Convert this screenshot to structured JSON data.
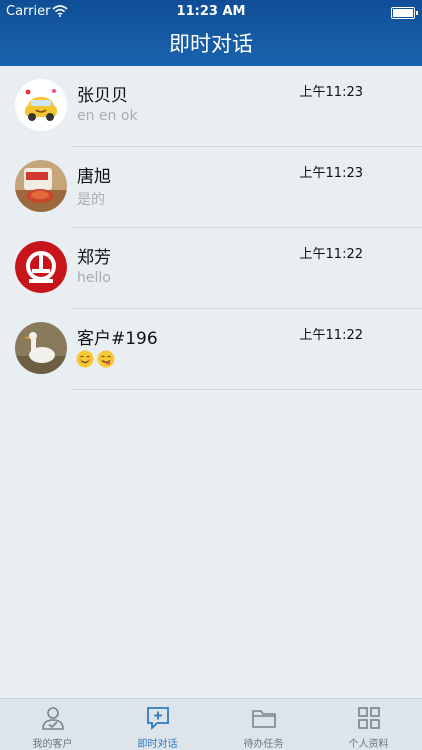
{
  "status_bar": {
    "carrier": "Carrier",
    "time": "11:23 AM"
  },
  "nav": {
    "title": "即时对话"
  },
  "conversations": [
    {
      "name": "张贝贝",
      "time": "上午11:23",
      "preview": "en en ok"
    },
    {
      "name": "唐旭",
      "time": "上午11:23",
      "preview": "是的"
    },
    {
      "name": "郑芳",
      "time": "上午11:22",
      "preview": "hello"
    },
    {
      "name": "客户#196",
      "time": "上午11:22",
      "preview": "😊😋"
    }
  ],
  "tabs": [
    {
      "label": "我的客户",
      "icon": "person-check-icon"
    },
    {
      "label": "即时对话",
      "icon": "chat-add-icon"
    },
    {
      "label": "待办任务",
      "icon": "folder-icon"
    },
    {
      "label": "个人资料",
      "icon": "grid-icon"
    }
  ],
  "colors": {
    "nav_bg": "#1a5aa6",
    "active_tab": "#2c7cc4",
    "background": "#e9eef2"
  }
}
